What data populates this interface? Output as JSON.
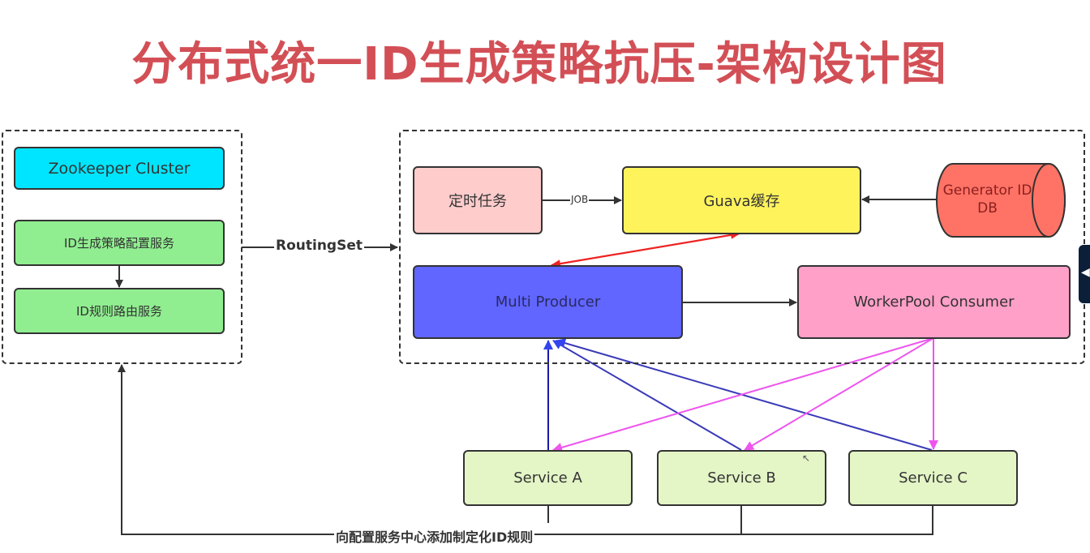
{
  "title": "分布式统一ID生成策略抗压-架构设计图",
  "left_group": {
    "zookeeper": "Zookeeper Cluster",
    "config_service": "ID生成策略配置服务",
    "routing_service": "ID规则路由服务"
  },
  "routing_label": "RoutingSet",
  "right_group": {
    "scheduled_task": "定时任务",
    "job_label": "JOB",
    "guava_cache": "Guava缓存",
    "generator_db_line1": "Generator ID",
    "generator_db_line2": "DB",
    "multi_producer": "Multi Producer",
    "workerpool_consumer": "WorkerPool Consumer"
  },
  "services": [
    {
      "label": "Service A"
    },
    {
      "label": "Service B"
    },
    {
      "label": "Service C"
    }
  ],
  "bottom_label": "向配置服务中心添加制定化ID规则",
  "colors": {
    "title": "#d34f56",
    "zookeeper": "#00e5ff",
    "config_green": "#90ee90",
    "scheduled_pink": "#ffcccc",
    "guava_yellow": "#fff35c",
    "db_red": "#ff7366",
    "producer_blue": "#6066ff",
    "consumer_pink": "#ffa0c8",
    "service_green": "#e4f5c6",
    "red_arrow": "#ee2222",
    "blue_arrow": "#3333cc",
    "magenta_arrow": "#ee55ee"
  },
  "side_tab_icon": "chevron-left-icon"
}
